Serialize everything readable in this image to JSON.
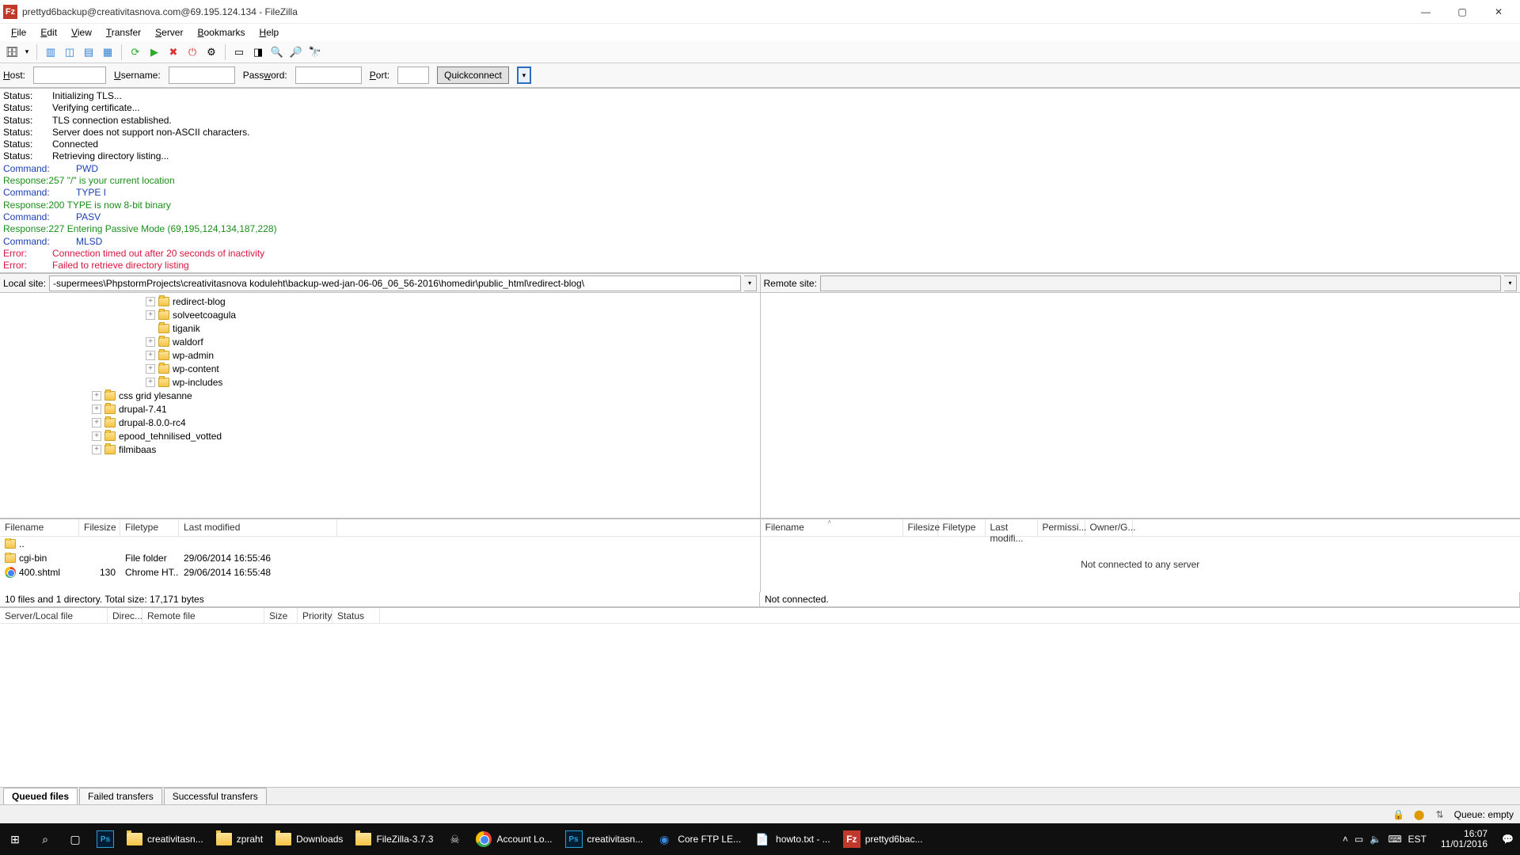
{
  "window": {
    "title": "prettyd6backup@creativitasnova.com@69.195.124.134 - FileZilla"
  },
  "menu": [
    "File",
    "Edit",
    "View",
    "Transfer",
    "Server",
    "Bookmarks",
    "Help"
  ],
  "quickconnect": {
    "host_label": "Host:",
    "user_label": "Username:",
    "pass_label": "Password:",
    "port_label": "Port:",
    "button": "Quickconnect",
    "host": "",
    "user": "",
    "pass": "",
    "port": ""
  },
  "log": [
    {
      "type": "status",
      "label": "Status:",
      "msg": "Initializing TLS..."
    },
    {
      "type": "status",
      "label": "Status:",
      "msg": "Verifying certificate..."
    },
    {
      "type": "status",
      "label": "Status:",
      "msg": "TLS connection established."
    },
    {
      "type": "status",
      "label": "Status:",
      "msg": "Server does not support non-ASCII characters."
    },
    {
      "type": "status",
      "label": "Status:",
      "msg": "Connected"
    },
    {
      "type": "status",
      "label": "Status:",
      "msg": "Retrieving directory listing..."
    },
    {
      "type": "command",
      "label": "Command:",
      "msg": "PWD"
    },
    {
      "type": "response",
      "label": "Response:",
      "msg": "257 \"/\" is your current location"
    },
    {
      "type": "command",
      "label": "Command:",
      "msg": "TYPE I"
    },
    {
      "type": "response",
      "label": "Response:",
      "msg": "200 TYPE is now 8-bit binary"
    },
    {
      "type": "command",
      "label": "Command:",
      "msg": "PASV"
    },
    {
      "type": "response",
      "label": "Response:",
      "msg": "227 Entering Passive Mode (69,195,124,134,187,228)"
    },
    {
      "type": "command",
      "label": "Command:",
      "msg": "MLSD"
    },
    {
      "type": "err",
      "label": "Error:",
      "msg": "Connection timed out after 20 seconds of inactivity"
    },
    {
      "type": "err",
      "label": "Error:",
      "msg": "Failed to retrieve directory listing"
    }
  ],
  "local": {
    "label": "Local site:",
    "path": "-supermees\\PhpstormProjects\\creativitasnova koduleht\\backup-wed-jan-06-06_06_56-2016\\homedir\\public_html\\redirect-blog\\",
    "tree": [
      {
        "indent": 180,
        "exp": "+",
        "name": "redirect-blog"
      },
      {
        "indent": 180,
        "exp": "+",
        "name": "solveetcoagula"
      },
      {
        "indent": 180,
        "exp": "",
        "name": "tiganik"
      },
      {
        "indent": 180,
        "exp": "+",
        "name": "waldorf"
      },
      {
        "indent": 180,
        "exp": "+",
        "name": "wp-admin"
      },
      {
        "indent": 180,
        "exp": "+",
        "name": "wp-content"
      },
      {
        "indent": 180,
        "exp": "+",
        "name": "wp-includes"
      },
      {
        "indent": 112,
        "exp": "+",
        "name": "css grid ylesanne"
      },
      {
        "indent": 112,
        "exp": "+",
        "name": "drupal-7.41"
      },
      {
        "indent": 112,
        "exp": "+",
        "name": "drupal-8.0.0-rc4"
      },
      {
        "indent": 112,
        "exp": "+",
        "name": "epood_tehnilised_votted"
      },
      {
        "indent": 112,
        "exp": "+",
        "name": "filmibaas"
      }
    ],
    "cols": [
      "Filename",
      "Filesize",
      "Filetype",
      "Last modified"
    ],
    "files": [
      {
        "icon": "folder",
        "name": "..",
        "size": "",
        "type": "",
        "mod": ""
      },
      {
        "icon": "folder",
        "name": "cgi-bin",
        "size": "",
        "type": "File folder",
        "mod": "29/06/2014 16:55:46"
      },
      {
        "icon": "chrome",
        "name": "400.shtml",
        "size": "130",
        "type": "Chrome HT...",
        "mod": "29/06/2014 16:55:48"
      }
    ],
    "summary": "10 files and 1 directory. Total size: 17,171 bytes"
  },
  "remote": {
    "label": "Remote site:",
    "path": "",
    "cols": [
      "Filename",
      "Filesize",
      "Filetype",
      "Last modifi...",
      "Permissi...",
      "Owner/G..."
    ],
    "body_msg": "Not connected to any server",
    "summary": "Not connected."
  },
  "queue": {
    "cols": [
      "Server/Local file",
      "Direc...",
      "Remote file",
      "Size",
      "Priority",
      "Status"
    ],
    "tabs": [
      "Queued files",
      "Failed transfers",
      "Successful transfers"
    ],
    "active_tab": 0
  },
  "statusbar": {
    "queue": "Queue: empty"
  },
  "taskbar": {
    "items": [
      {
        "icon": "ps",
        "label": ""
      },
      {
        "icon": "folder",
        "label": "creativitasn..."
      },
      {
        "icon": "folder",
        "label": "zpraht"
      },
      {
        "icon": "folder",
        "label": "Downloads"
      },
      {
        "icon": "folder",
        "label": "FileZilla-3.7.3"
      },
      {
        "icon": "skull",
        "label": ""
      },
      {
        "icon": "chrome",
        "label": "Account Lo..."
      },
      {
        "icon": "ps",
        "label": "creativitasn..."
      },
      {
        "icon": "core",
        "label": "Core FTP LE..."
      },
      {
        "icon": "note",
        "label": "howto.txt - ..."
      },
      {
        "icon": "fz",
        "label": "prettyd6bac..."
      }
    ],
    "lang": "EST",
    "time": "16:07",
    "date": "11/01/2016"
  }
}
